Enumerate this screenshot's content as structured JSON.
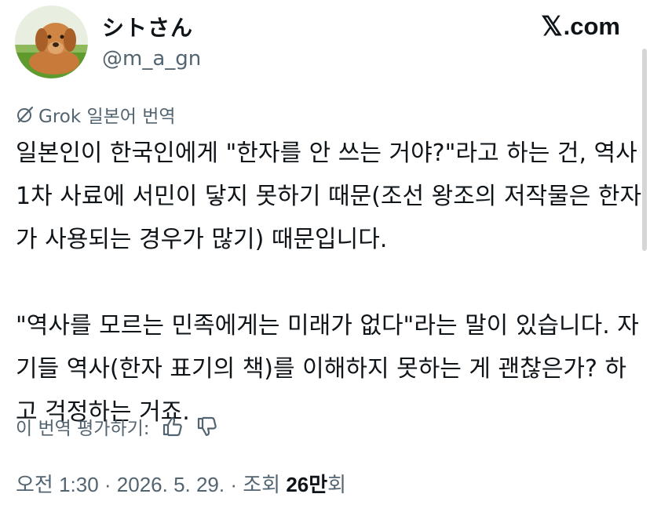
{
  "author": {
    "display_name": "シトさん",
    "handle": "@m_a_gn"
  },
  "brand": {
    "x_glyph": "𝕏",
    "label": ".com"
  },
  "translation": {
    "label": "Grok 일본어 번역"
  },
  "tweet": {
    "line1": "일본인이 한국인에게 \"한자를 안 쓰는 거야?\"라고 하는 건, 역사 1차 사료에 서민이 닿지 못하기 때문(조선 왕조의 저작물은 한자가 사용되는 경우가 많기) 때문입니다.",
    "line2": "\"역사를 모르는 민족에게는 미래가 없다\"라는 말이 있습니다. 자기들 역사(한자 표기의 책)를 이해하지 못하는 게 괜찮은가? 하고 걱정하는 거죠."
  },
  "rating": {
    "label": "이 번역 평가하기:"
  },
  "meta": {
    "time": "오전 1:30",
    "separator": " · ",
    "date": "2026. 5. 29.",
    "views_prefix": "조회 ",
    "views_count": "26만",
    "views_suffix": "회"
  }
}
